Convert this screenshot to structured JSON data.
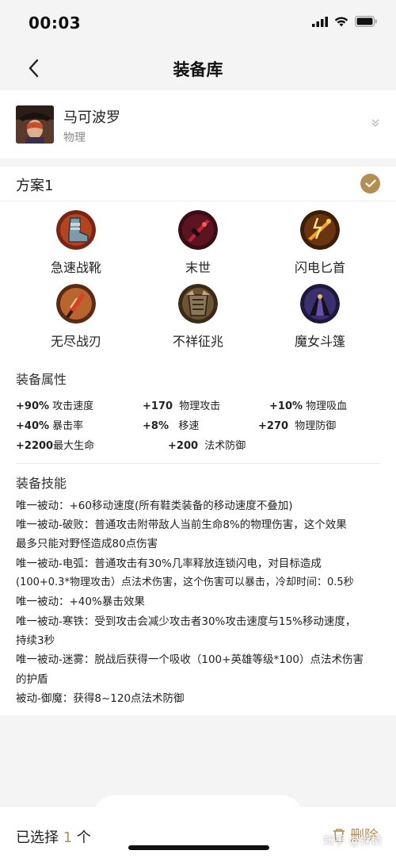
{
  "status": {
    "time": "00:03"
  },
  "nav": {
    "title": "装备库",
    "back_icon": "chevron-left-icon"
  },
  "hero": {
    "name": "马可波罗",
    "type": "物理"
  },
  "plan": {
    "title": "方案1",
    "items": [
      {
        "label": "急速战靴",
        "icon": "boots-icon"
      },
      {
        "label": "末世",
        "icon": "doom-blade-icon"
      },
      {
        "label": "闪电匕首",
        "icon": "lightning-dagger-icon"
      },
      {
        "label": "无尽战刃",
        "icon": "infinity-blade-icon"
      },
      {
        "label": "不祥征兆",
        "icon": "ominous-armor-icon"
      },
      {
        "label": "魔女斗篷",
        "icon": "witch-cloak-icon"
      }
    ],
    "attributes_title": "装备属性",
    "attributes": [
      {
        "value": "+90%",
        "name": "攻击速度"
      },
      {
        "value": "+170",
        "name": "物理攻击"
      },
      {
        "value": "+10%",
        "name": "物理吸血"
      },
      {
        "value": "+40%",
        "name": "暴击率"
      },
      {
        "value": "+8%",
        "name": "移速"
      },
      {
        "value": "+270",
        "name": "物理防御"
      },
      {
        "value": "+2200",
        "name": "最大生命"
      },
      {
        "value": "+200",
        "name": "法术防御"
      }
    ],
    "skills_title": "装备技能",
    "skill_lines": [
      "唯一被动：+60移动速度(所有鞋类装备的移动速度不叠加)",
      "唯一被动-破败：普通攻击附带敌人当前生命8%的物理伤害，这个效果",
      "最多只能对野怪造成80点伤害",
      "唯一被动-电弧：普通攻击有30%几率释放连锁闪电，对目标造成",
      "(100+0.3*物理攻击）点法术伤害，这个伤害可以暴击，冷却时间：0.5秒",
      "唯一被动：+40%暴击效果",
      "唯一被动-寒铁：受到攻击会减少攻击者30%攻击速度与15%移动速度，",
      "持续3秒",
      "唯一被动-迷雾：脱战后获得一个吸收（100+英雄等级*100）点法术伤害",
      "的护盾",
      "被动-御魔：获得8~120点法术防御"
    ]
  },
  "bottom": {
    "selected_prefix": "已选择",
    "selected_count": "1",
    "selected_suffix": "个",
    "delete_label": "删除"
  },
  "watermark": "知乎 @探桥",
  "colors": {
    "accent": "#b58e55",
    "background": "#f4f4f4"
  }
}
